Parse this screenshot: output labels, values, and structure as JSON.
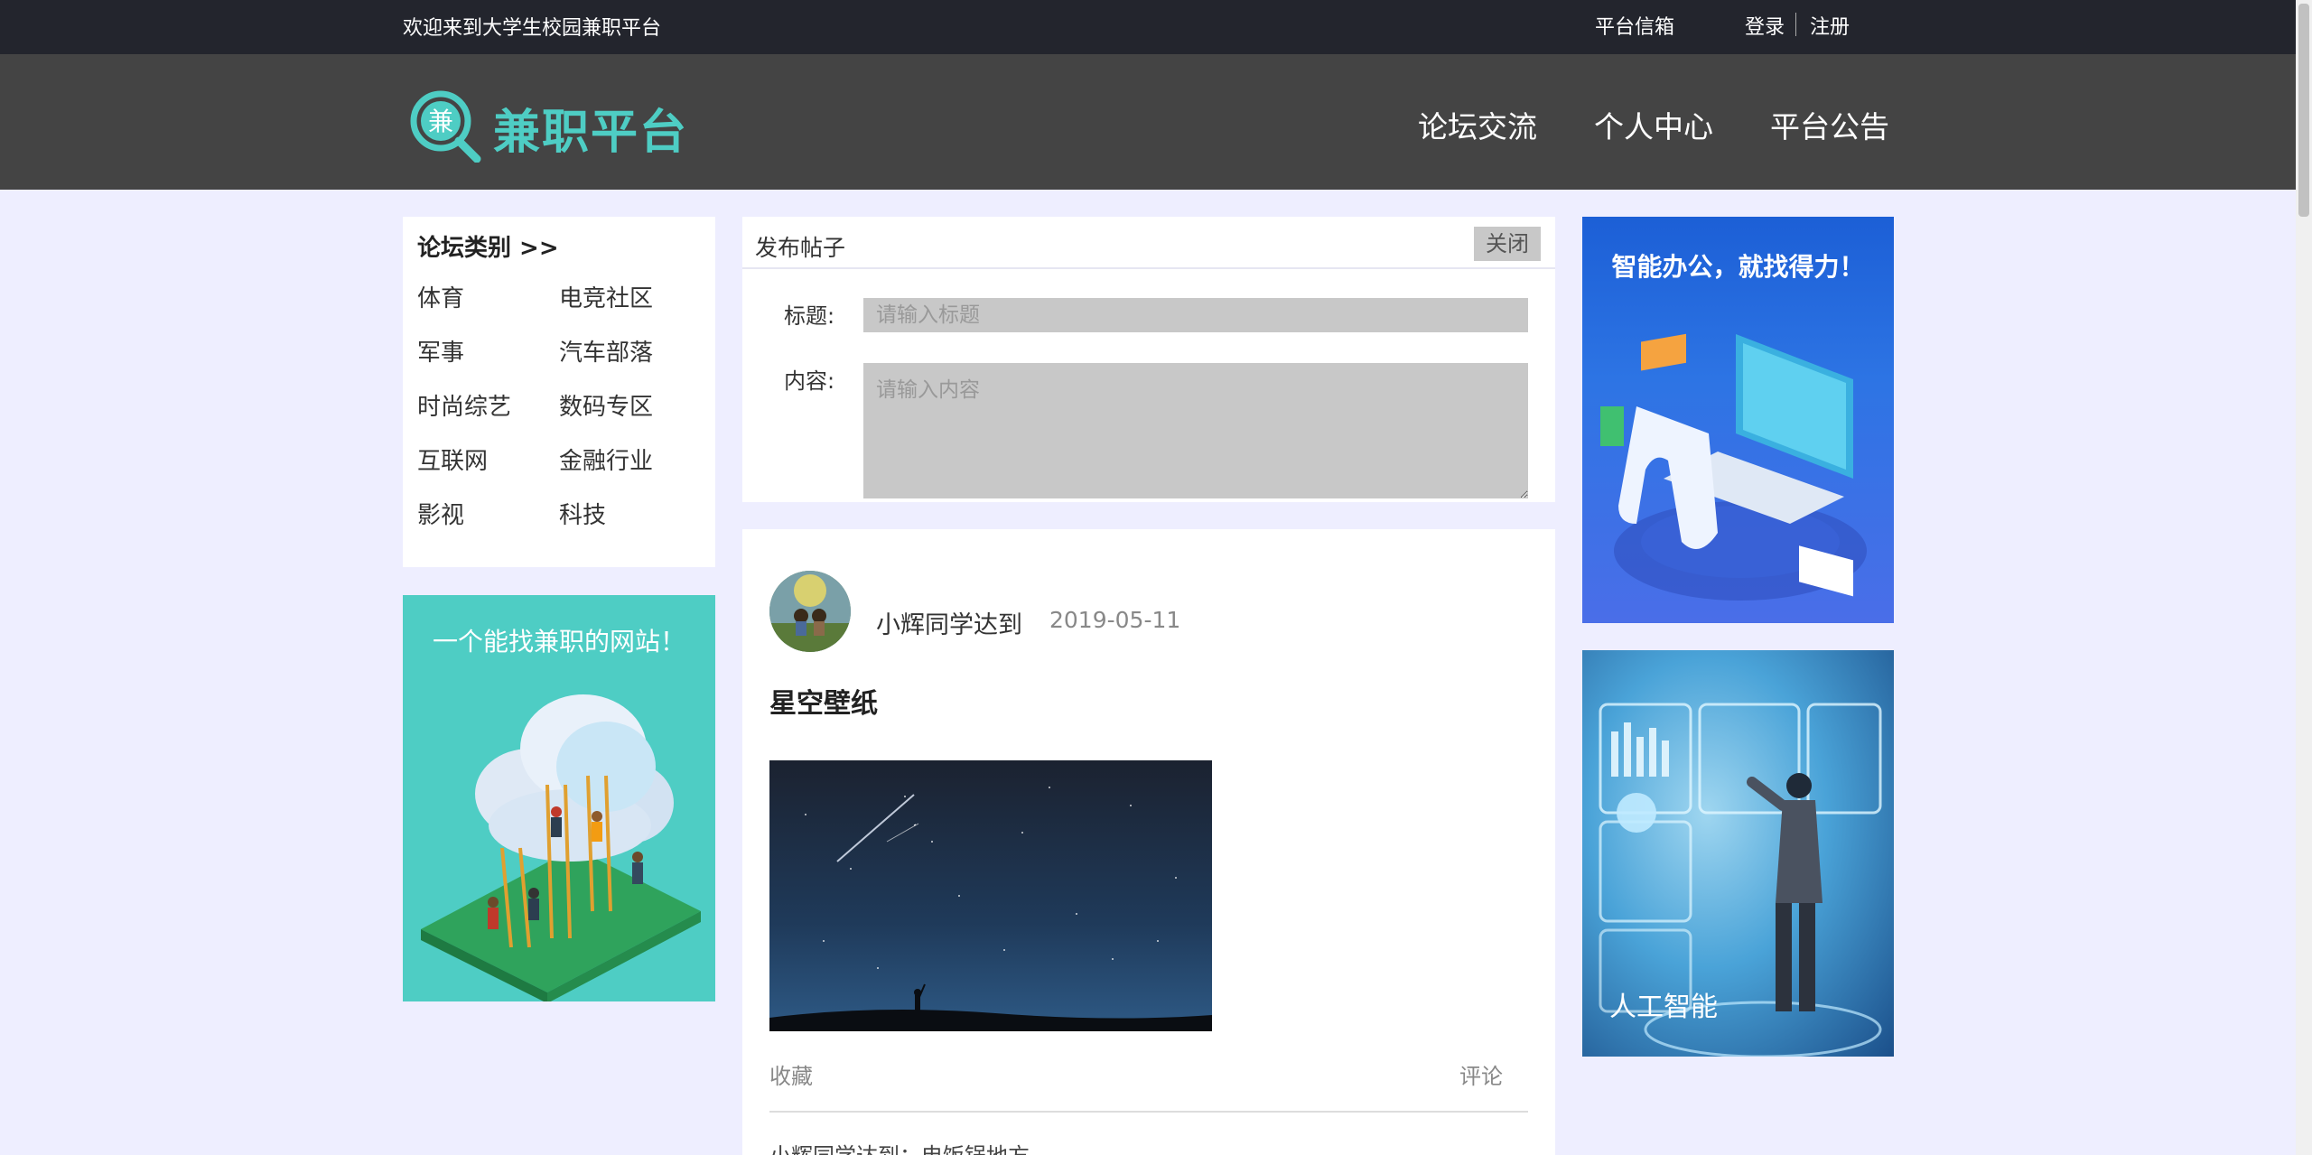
{
  "topbar": {
    "welcome": "欢迎来到大学生校园兼职平台",
    "inbox": "平台信箱",
    "login": "登录",
    "register": "注册"
  },
  "header": {
    "logo_char": "兼",
    "logo_text": "兼职平台",
    "nav": [
      "论坛交流",
      "个人中心",
      "平台公告"
    ]
  },
  "categories": {
    "title": "论坛类别 >>",
    "items": [
      "体育",
      "电竞社区",
      "军事",
      "汽车部落",
      "时尚综艺",
      "数码专区",
      "互联网",
      "金融行业",
      "影视",
      "科技"
    ]
  },
  "left_ad": {
    "caption": "一个能找兼职的网站！"
  },
  "publish": {
    "title": "发布帖子",
    "close": "关闭",
    "title_label": "标题:",
    "title_placeholder": "请输入标题",
    "content_label": "内容:",
    "content_placeholder": "请输入内容"
  },
  "post": {
    "author": "小辉同学达到",
    "date": "2019-05-11",
    "title": "星空壁纸",
    "favorite": "收藏",
    "comment": "评论",
    "reply": "小辉同学达到：电饭锅地方"
  },
  "right_ads": {
    "ad1_caption": "智能办公，就找得力！",
    "ad2_caption": "人工智能"
  },
  "colors": {
    "accent": "#4ecdc4",
    "topbar": "#23252d",
    "header": "#444444",
    "page_bg": "#eeeeff"
  }
}
